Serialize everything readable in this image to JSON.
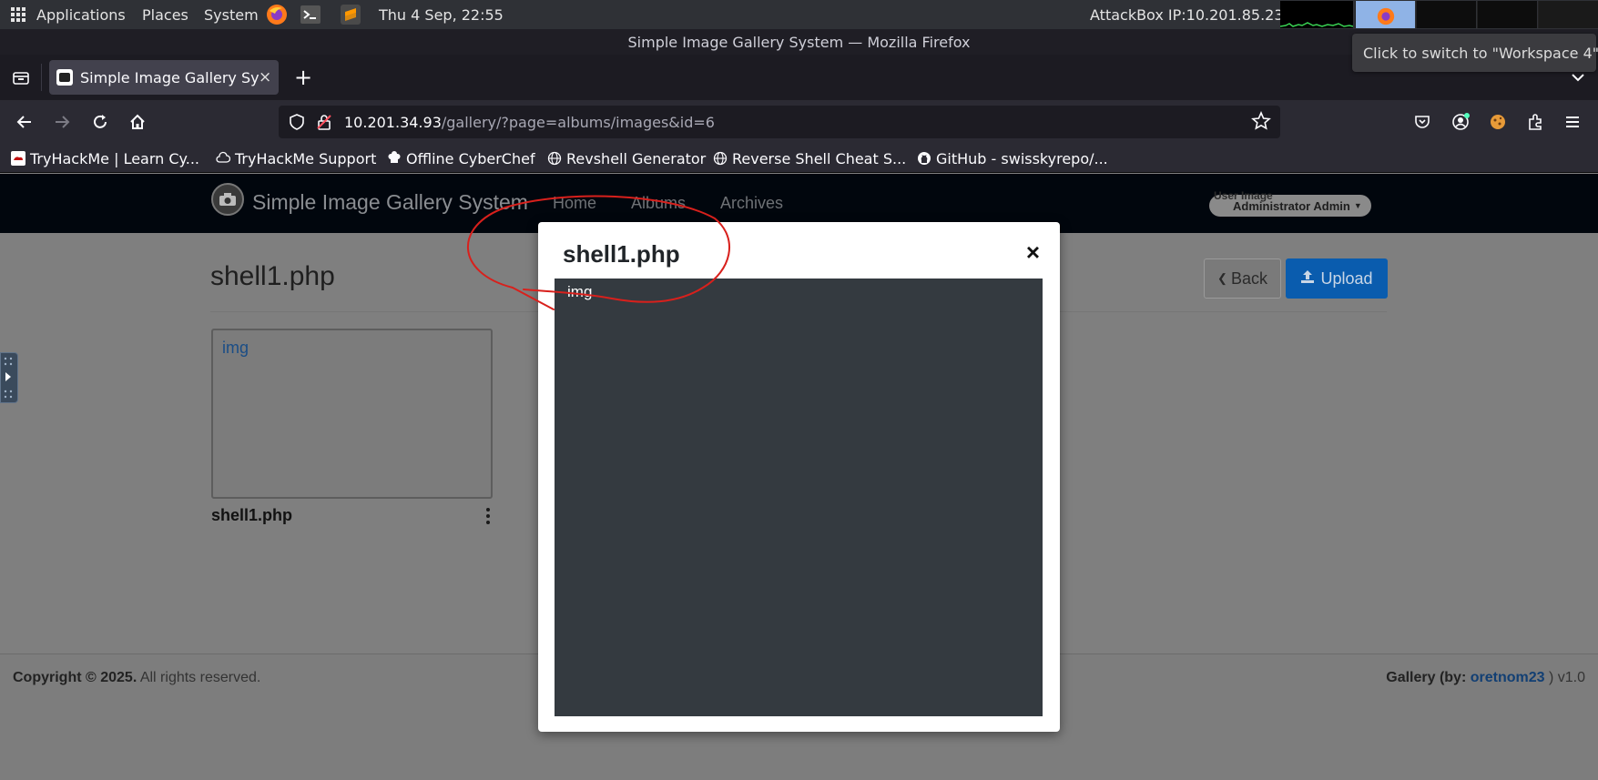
{
  "panel": {
    "applications": "Applications",
    "places": "Places",
    "system": "System",
    "datetime": "Thu  4 Sep, 22:55",
    "attackbox_ip": "AttackBox IP:10.201.85.239",
    "workspace_tooltip": "Click to switch to \"Workspace 4\""
  },
  "firefox": {
    "window_title": "Simple Image Gallery System — Mozilla Firefox",
    "tab_title": "Simple Image Gallery Sys",
    "tab_close": "×",
    "new_tab": "+",
    "url_host": "10.201.34.93",
    "url_path": "/gallery/?page=albums/images&id=6",
    "bookmarks": [
      "TryHackMe | Learn Cy...",
      "TryHackMe Support",
      "Offline CyberChef",
      "Revshell Generator",
      "Reverse Shell Cheat S...",
      "GitHub - swisskyrepo/..."
    ]
  },
  "site": {
    "brand": "Simple Image Gallery System",
    "nav": [
      "Home",
      "Albums",
      "Archives"
    ],
    "user_image_alt": "User Image",
    "user_name": "Administrator Admin",
    "album_title": "shell1.php",
    "back_label": "Back",
    "upload_label": "Upload",
    "card_img_alt": "img",
    "card_name": "shell1.php",
    "footer_copyright_bold": "Copyright © 2025.",
    "footer_copyright_rest": " All rights reserved.",
    "footer_credit_prefix": "Gallery (by: ",
    "footer_credit_author": "oretnom23",
    "footer_credit_suffix": " ) v1.0"
  },
  "modal": {
    "title": "shell1.php",
    "close": "×",
    "img_alt": "img"
  },
  "colors": {
    "annotation_red": "#d8201c",
    "upload_blue": "#0a5cae",
    "modal_body": "#343a40"
  }
}
